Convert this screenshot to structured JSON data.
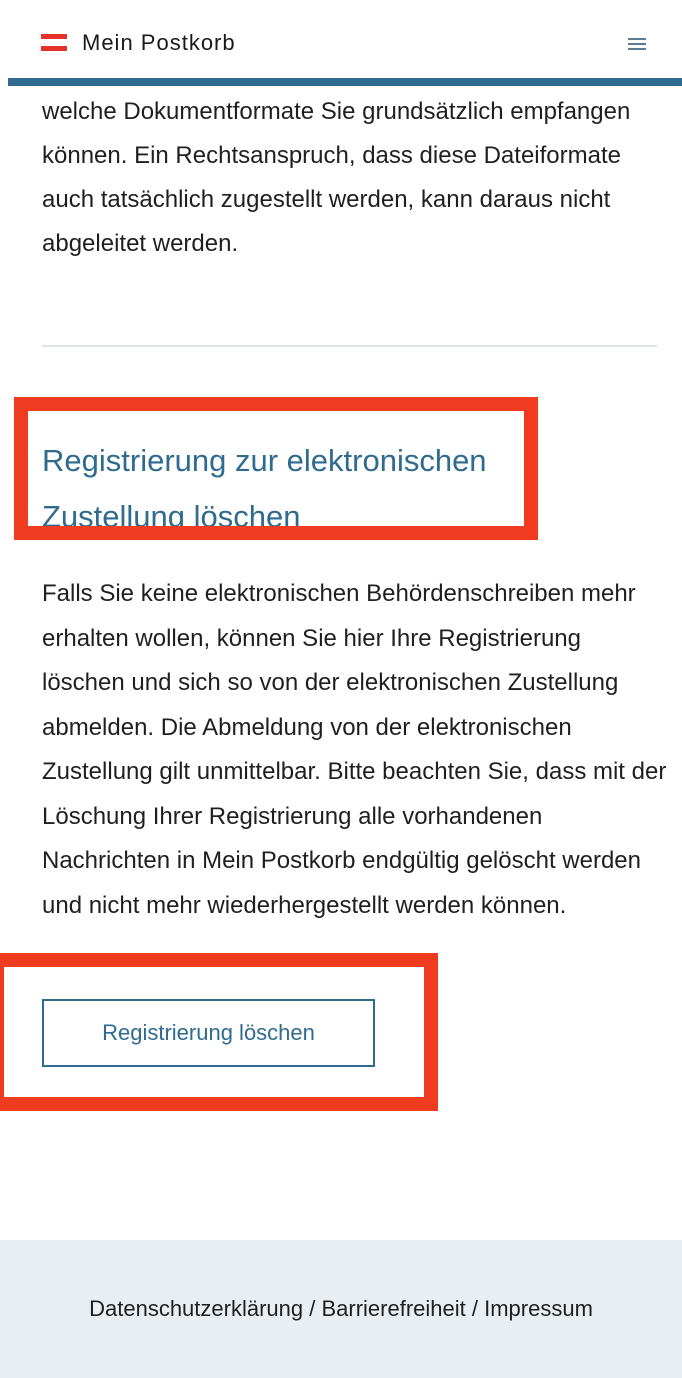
{
  "header": {
    "title": "Mein Postkorb",
    "brand_flag_colors": [
      "#e4322b",
      "#ffffff",
      "#e4322b"
    ],
    "accent_color": "#2f6b8f",
    "menu_icon": "hamburger-menu-icon"
  },
  "main": {
    "intro_text": "welche Dokumentformate Sie grundsätzlich empfangen können. Ein Rechtsanspruch, dass diese Dateiformate auch tatsächlich zugestellt werden, kann daraus nicht abgeleitet werden.",
    "section_heading": "Registrierung zur elektronischen Zustellung löschen",
    "section_body": "Falls Sie keine elektronischen Behördenschreiben mehr erhalten wollen, können Sie hier Ihre Registrierung löschen und sich so von der elektronischen Zustellung abmelden. Die Abmeldung von der elektronischen Zustellung gilt unmittelbar. Bitte beachten Sie, dass mit der Löschung Ihrer Registrierung alle vorhandenen Nachrichten in Mein Postkorb endgültig gelöscht werden und nicht mehr wiederhergestellt werden können.",
    "delete_button_label": "Registrierung löschen"
  },
  "annotations": {
    "highlight_color": "#ef3b1f"
  },
  "footer": {
    "links": [
      "Datenschutzerklärung",
      "Barrierefreiheit",
      "Impressum"
    ],
    "separator": " / ",
    "background_color": "#e8eef2"
  }
}
